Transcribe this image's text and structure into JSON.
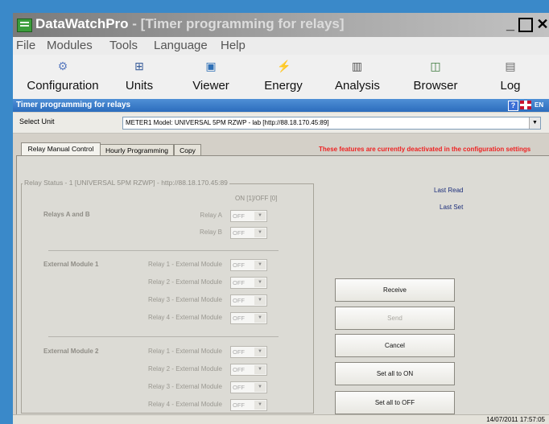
{
  "window": {
    "app_name": "DataWatchPro",
    "title_suffix": "- [Timer programming for relays]",
    "minimize": "_",
    "maximize": "□",
    "close": "✕"
  },
  "menu": [
    "File",
    "Modules",
    "Tools",
    "Language",
    "Help"
  ],
  "toolbar": [
    {
      "label": "Configuration",
      "icon": "gear-icon"
    },
    {
      "label": "Units",
      "icon": "network-icon"
    },
    {
      "label": "Viewer",
      "icon": "monitor-icon"
    },
    {
      "label": "Energy",
      "icon": "lightning-icon"
    },
    {
      "label": "Analysis",
      "icon": "chart-icon"
    },
    {
      "label": "Browser",
      "icon": "browser-icon"
    },
    {
      "label": "Log",
      "icon": "log-icon"
    }
  ],
  "panel": {
    "title": "Timer programming for relays",
    "help": "?",
    "lang": "EN"
  },
  "select_unit": {
    "label": "Select Unit",
    "value": "METER1  Model: UNIVERSAL 5PM RZWP - lab [http://88.18.170.45:89]"
  },
  "tabs": [
    "Relay Manual Control",
    "Hourly Programming",
    "Copy"
  ],
  "warning": "These features are currently deactivated in the configuration settings",
  "relay_status": {
    "group_title": "Relay Status - 1 [UNIVERSAL 5PM RZWP] - http://88.18.170.45:89",
    "on_off_header": "ON [1]/OFF [0]",
    "sections": [
      {
        "name": "Relays A and B",
        "relays": [
          {
            "label": "Relay A",
            "value": "OFF"
          },
          {
            "label": "Relay B",
            "value": "OFF"
          }
        ]
      },
      {
        "name": "External Module 1",
        "relays": [
          {
            "label": "Relay 1 - External Module",
            "value": "OFF"
          },
          {
            "label": "Relay 2 - External Module",
            "value": "OFF"
          },
          {
            "label": "Relay 3 - External Module",
            "value": "OFF"
          },
          {
            "label": "Relay 4 - External Module",
            "value": "OFF"
          }
        ]
      },
      {
        "name": "External Module 2",
        "relays": [
          {
            "label": "Relay 1 - External Module",
            "value": "OFF"
          },
          {
            "label": "Relay 2 - External Module",
            "value": "OFF"
          },
          {
            "label": "Relay 3 - External Module",
            "value": "OFF"
          },
          {
            "label": "Relay 4 - External Module",
            "value": "OFF"
          }
        ]
      }
    ]
  },
  "info": {
    "last_read": "Last Read",
    "last_set": "Last Set"
  },
  "buttons": {
    "receive": "Receive",
    "send": "Send",
    "cancel": "Cancel",
    "set_all_on": "Set all to ON",
    "set_all_off": "Set all to OFF"
  },
  "status_bar": {
    "datetime": "14/07/2011  17:57:05"
  }
}
